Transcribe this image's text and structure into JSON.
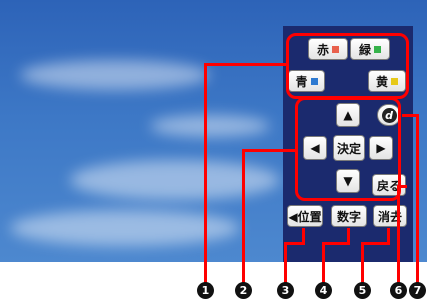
{
  "colors": {
    "red": "#e8604c",
    "green": "#35b24a",
    "blue": "#2e7ad1",
    "yellow": "#e7c918",
    "highlight": "#ff0000"
  },
  "color_keys": {
    "red": "赤",
    "green": "緑",
    "blue": "青",
    "yellow": "黄"
  },
  "dpad": {
    "up": "▲",
    "down": "▼",
    "left": "◀",
    "right": "▶",
    "center": "決定"
  },
  "keys": {
    "d": "d",
    "back": "戻る",
    "position": "◀位置",
    "number": "数字",
    "delete": "消去"
  },
  "callouts": [
    "1",
    "2",
    "3",
    "4",
    "5",
    "6",
    "7"
  ]
}
